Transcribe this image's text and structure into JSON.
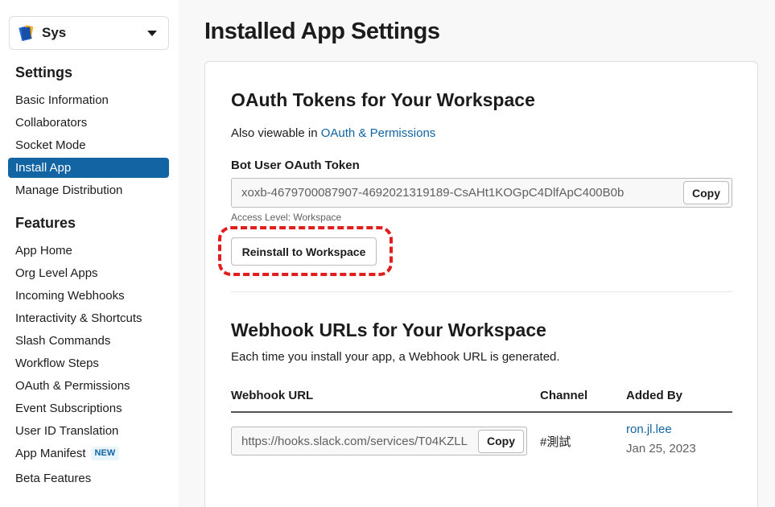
{
  "sidebar": {
    "app_name": "Sys",
    "settings_heading": "Settings",
    "settings_items": [
      {
        "label": "Basic Information"
      },
      {
        "label": "Collaborators"
      },
      {
        "label": "Socket Mode"
      },
      {
        "label": "Install App"
      },
      {
        "label": "Manage Distribution"
      }
    ],
    "features_heading": "Features",
    "features_items": [
      {
        "label": "App Home"
      },
      {
        "label": "Org Level Apps"
      },
      {
        "label": "Incoming Webhooks"
      },
      {
        "label": "Interactivity & Shortcuts"
      },
      {
        "label": "Slash Commands"
      },
      {
        "label": "Workflow Steps"
      },
      {
        "label": "OAuth & Permissions"
      },
      {
        "label": "Event Subscriptions"
      },
      {
        "label": "User ID Translation"
      },
      {
        "label": "App Manifest"
      },
      {
        "label": "Beta Features"
      }
    ],
    "new_badge": "NEW",
    "active_item": "Install App"
  },
  "main": {
    "page_title": "Installed App Settings",
    "oauth": {
      "heading": "OAuth Tokens for Your Workspace",
      "also_viewable_prefix": "Also viewable in ",
      "also_viewable_link": "OAuth & Permissions",
      "token_label": "Bot User OAuth Token",
      "token_value": "xoxb-4679700087907-4692021319189-CsAHt1KOGpC4DlfApC400B0b",
      "copy_label": "Copy",
      "access_level": "Access Level: Workspace",
      "reinstall_label": "Reinstall to Workspace"
    },
    "webhooks": {
      "heading": "Webhook URLs for Your Workspace",
      "description": "Each time you install your app, a Webhook URL is generated.",
      "columns": [
        "Webhook URL",
        "Channel",
        "Added By"
      ],
      "rows": [
        {
          "url": "https://hooks.slack.com/services/T04KZLL",
          "copy_label": "Copy",
          "channel": "#測試",
          "added_by": "ron.jl.lee",
          "date": "Jan 25, 2023"
        }
      ]
    }
  },
  "colors": {
    "accent": "#1264a3",
    "highlight": "#e01e1e"
  }
}
